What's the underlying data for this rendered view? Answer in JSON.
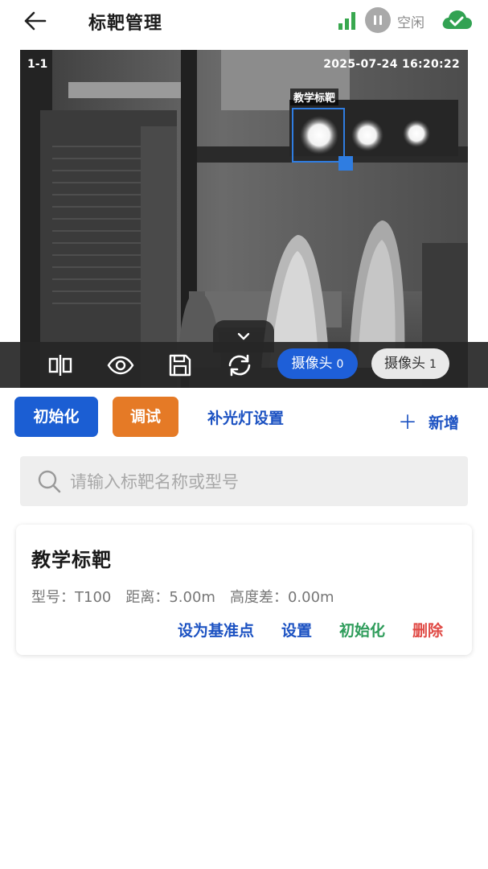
{
  "header": {
    "title": "标靶管理",
    "status": "空闲",
    "signal_icon": "signal-bars-icon",
    "status_icon": "pause-circle-icon",
    "cloud_icon": "cloud-check-icon"
  },
  "camera_view": {
    "camera_id": "1-1",
    "timestamp": "2025-07-24 16:20:22",
    "target_label": "教学标靶",
    "toolbar": {
      "icons": [
        "split-view-icon",
        "eye-icon",
        "save-icon",
        "refresh-icon"
      ],
      "camera_tabs": [
        {
          "label": "摄像头",
          "num": "0",
          "active": true
        },
        {
          "label": "摄像头",
          "num": "1",
          "active": false
        }
      ]
    }
  },
  "actions": {
    "init_label": "初始化",
    "debug_label": "调试",
    "fill_light_label": "补光灯设置",
    "add_label": "新增"
  },
  "search": {
    "placeholder": "请输入标靶名称或型号"
  },
  "targets": [
    {
      "name": "教学标靶",
      "model": "型号：T100",
      "distance": "距离：5.00m",
      "height_diff": "高度差：0.00m",
      "actions": {
        "set_base": "设为基准点",
        "settings": "设置",
        "init": "初始化",
        "delete": "删除"
      }
    }
  ],
  "colors": {
    "primary": "#1b5ed3",
    "orange": "#e57a26",
    "green": "#2e9c5a",
    "danger": "#e04a45",
    "signal": "#39a84f",
    "highlight_box": "#2f7de1"
  }
}
